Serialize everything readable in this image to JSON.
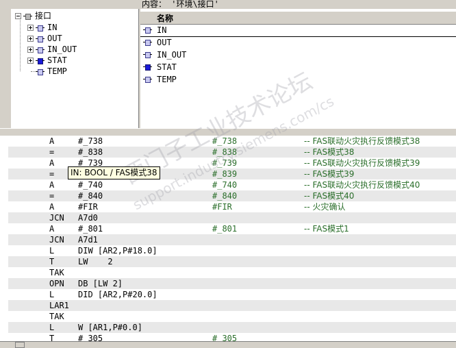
{
  "list_header": "内容： '环境\\接口'",
  "tree": {
    "root": "接口",
    "items": [
      {
        "label": "IN",
        "icon": "in-param-icon"
      },
      {
        "label": "OUT",
        "icon": "out-param-icon"
      },
      {
        "label": "IN_OUT",
        "icon": "inout-param-icon"
      },
      {
        "label": "STAT",
        "icon": "stat-param-icon"
      },
      {
        "label": "TEMP",
        "icon": "temp-param-icon"
      }
    ]
  },
  "list": {
    "column": "名称",
    "rows": [
      {
        "label": "IN"
      },
      {
        "label": "OUT"
      },
      {
        "label": "IN_OUT"
      },
      {
        "label": "STAT"
      },
      {
        "label": "TEMP"
      }
    ]
  },
  "code": [
    {
      "op": "A",
      "operand": "#_738",
      "sym": "#_738",
      "comment": "-- FAS联动火灾执行反馈模式38"
    },
    {
      "op": "=",
      "operand": "#_838",
      "sym": "#_838",
      "comment": "-- FAS模式38"
    },
    {
      "op": "A",
      "operand": "#_739",
      "sym": "#_739",
      "comment": "-- FAS联动火灾执行反馈模式39"
    },
    {
      "op": "=",
      "operand": "",
      "sym": "#_839",
      "comment": "-- FAS模式39"
    },
    {
      "op": "A",
      "operand": "#_740",
      "sym": "#_740",
      "comment": "-- FAS联动火灾执行反馈模式40"
    },
    {
      "op": "=",
      "operand": "#_840",
      "sym": "#_840",
      "comment": "-- FAS模式40"
    },
    {
      "op": "A",
      "operand": "#FIR",
      "sym": "#FIR",
      "comment": "-- 火灾确认"
    },
    {
      "op": "JCN",
      "operand": "A7d0",
      "sym": "",
      "comment": ""
    },
    {
      "op": "A",
      "operand": "#_801",
      "sym": "#_801",
      "comment": "-- FAS模式1"
    },
    {
      "op": "JCN",
      "operand": "A7d1",
      "sym": "",
      "comment": ""
    },
    {
      "op": "L",
      "operand": "DIW [AR2,P#18.0]",
      "sym": "",
      "comment": ""
    },
    {
      "op": "T",
      "operand": "LW    2",
      "sym": "",
      "comment": ""
    },
    {
      "op": "TAK",
      "operand": "",
      "sym": "",
      "comment": ""
    },
    {
      "op": "OPN",
      "operand": "DB [LW 2]",
      "sym": "",
      "comment": ""
    },
    {
      "op": "L",
      "operand": "DID [AR2,P#20.0]",
      "sym": "",
      "comment": ""
    },
    {
      "op": "LAR1",
      "operand": "",
      "sym": "",
      "comment": ""
    },
    {
      "op": "TAK",
      "operand": "",
      "sym": "",
      "comment": ""
    },
    {
      "op": "L",
      "operand": "W [AR1,P#0.0]",
      "sym": "",
      "comment": ""
    },
    {
      "op": "T",
      "operand": "#_305",
      "sym": "#_305",
      "comment": ""
    }
  ],
  "tooltip": "IN: BOOL / FAS模式38",
  "watermark": "西门子工业技术论坛",
  "watermark_url": "support.industry.siemens.com/cs"
}
